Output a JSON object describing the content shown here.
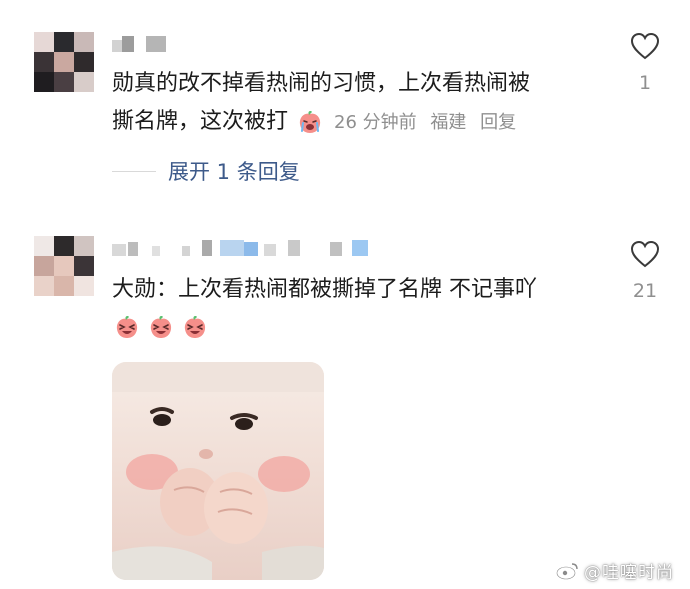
{
  "comments": [
    {
      "line1": "勋真的改不掉看热闹的习惯，上次看热闹被",
      "line2": "撕名牌，这次被打",
      "time": "26 分钟前",
      "location": "福建",
      "reply_label": "回复",
      "like_count": "1",
      "expand_label": "展开 1 条回复"
    },
    {
      "text": "大勋：上次看热闹都被撕掉了名牌 不记事吖",
      "like_count": "21"
    }
  ],
  "watermark": "@哇噻时尚",
  "icons": {
    "like": "heart-outline-icon",
    "crying_emoji": "crying-peach-emoji-icon",
    "laughing_emoji": "laughing-peach-emoji-icon",
    "weibo": "weibo-logo-icon"
  },
  "colors": {
    "link": "#3d5a8a",
    "meta_gray": "#8f8f8f",
    "emoji_pink": "#f58f8a",
    "emoji_leaf": "#5bbf6e"
  }
}
